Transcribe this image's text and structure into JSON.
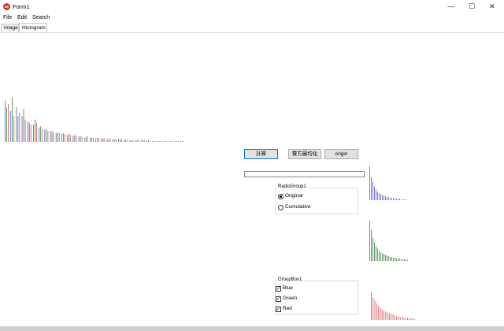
{
  "window": {
    "title": "Form1",
    "icon": "app-icon",
    "icon_glyph": "XE",
    "controls": {
      "minimize": "—",
      "maximize": "☐",
      "close": "✕"
    }
  },
  "menu": [
    "File",
    "Edit",
    "Search"
  ],
  "tabs": [
    {
      "label": "image",
      "active": false
    },
    {
      "label": "Histogram",
      "active": true
    }
  ],
  "buttons": {
    "calc": "計算",
    "equalize": "賛方圖均化",
    "origin": "origin"
  },
  "progress": {
    "value": 0
  },
  "radio_group": {
    "caption": "RadioGroup1",
    "options": [
      {
        "label": "Original",
        "checked": true
      },
      {
        "label": "Cumulative",
        "checked": false
      }
    ]
  },
  "check_group": {
    "caption": "GroupBox1",
    "items": [
      {
        "label": "Blue",
        "checked": true
      },
      {
        "label": "Green",
        "checked": true
      },
      {
        "label": "Red",
        "checked": true
      }
    ]
  },
  "colors": {
    "blue": "#6b6bd6",
    "green": "#4f8f4f",
    "red": "#e06060",
    "accent": "#0078d7"
  },
  "chart_data": [
    {
      "type": "bar",
      "name": "main-histogram",
      "series": [
        {
          "color": "blue",
          "values": [
            48,
            36,
            40,
            30,
            24,
            20,
            16,
            14,
            12,
            10,
            9,
            8,
            7,
            6,
            5,
            5,
            4,
            4,
            3,
            3,
            3,
            2,
            2,
            2,
            2,
            2,
            1,
            1,
            1,
            1,
            1,
            1
          ]
        },
        {
          "color": "green",
          "values": [
            40,
            52,
            30,
            38,
            22,
            26,
            18,
            15,
            13,
            11,
            10,
            9,
            8,
            7,
            6,
            5,
            5,
            4,
            4,
            3,
            3,
            3,
            2,
            2,
            2,
            2,
            1,
            1,
            1,
            1,
            1,
            1
          ]
        },
        {
          "color": "red",
          "values": [
            44,
            30,
            34,
            26,
            20,
            22,
            15,
            13,
            11,
            10,
            9,
            8,
            7,
            6,
            6,
            5,
            4,
            4,
            3,
            3,
            3,
            2,
            2,
            2,
            2,
            1,
            1,
            1,
            1,
            1,
            1,
            1
          ]
        }
      ],
      "ylim": [
        0,
        55
      ]
    },
    {
      "type": "bar",
      "name": "blue-histogram",
      "color": "blue",
      "values": [
        44,
        30,
        24,
        18,
        14,
        11,
        9,
        8,
        7,
        6,
        5,
        4,
        4,
        3,
        3,
        3,
        2,
        2,
        2,
        2,
        1,
        1,
        1,
        1
      ],
      "ylim": [
        0,
        45
      ]
    },
    {
      "type": "bar",
      "name": "green-histogram",
      "color": "green",
      "values": [
        52,
        40,
        30,
        24,
        19,
        16,
        13,
        11,
        10,
        9,
        8,
        7,
        6,
        5,
        5,
        4,
        4,
        3,
        3,
        3,
        2,
        2,
        2,
        2,
        1
      ],
      "ylim": [
        0,
        55
      ]
    },
    {
      "type": "bar",
      "name": "red-histogram",
      "color": "red",
      "values": [
        38,
        30,
        26,
        22,
        19,
        16,
        14,
        12,
        11,
        10,
        9,
        8,
        7,
        6,
        5,
        5,
        4,
        4,
        3,
        3,
        3,
        2,
        2,
        2,
        1
      ],
      "ylim": [
        0,
        40
      ]
    }
  ]
}
